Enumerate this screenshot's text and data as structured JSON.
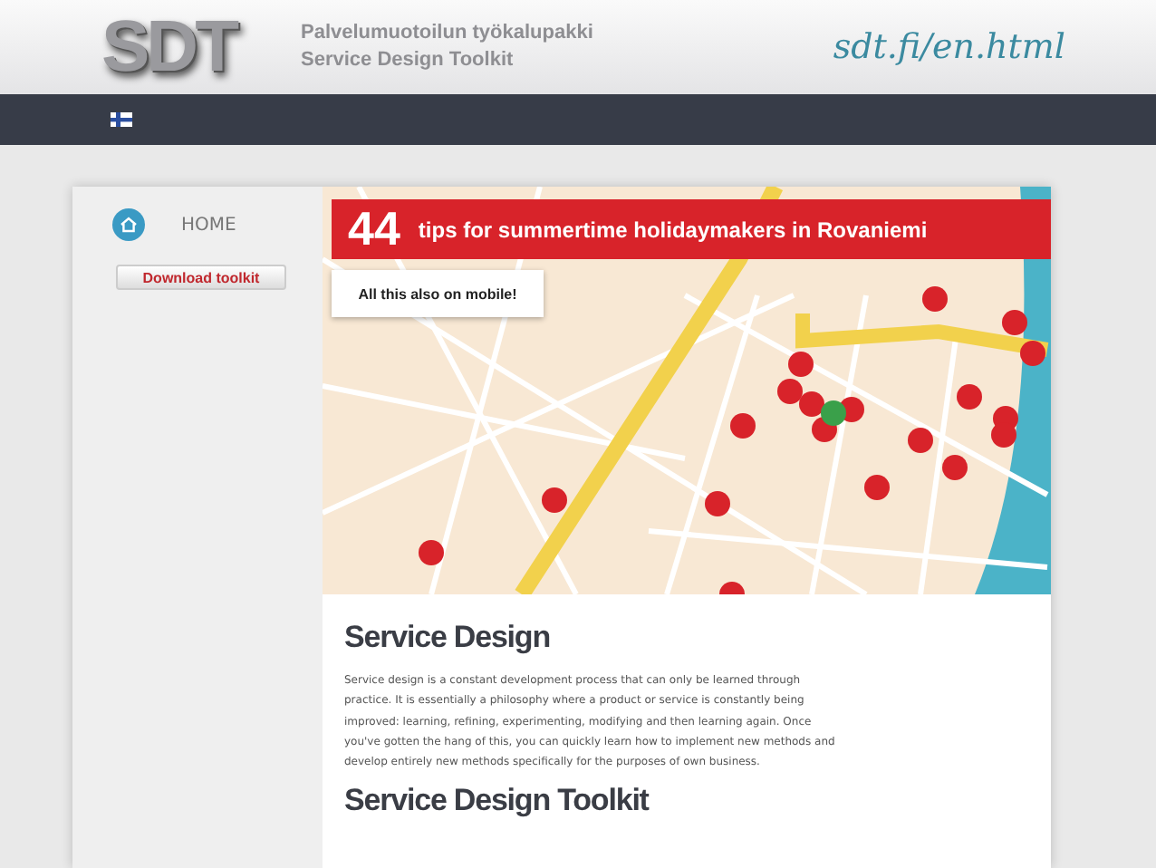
{
  "header": {
    "logo": "SDT",
    "tagline_fi": "Palvelumuotoilun työkalupakki",
    "tagline_en": "Service Design Toolkit",
    "url": "sdt.fi/en.html"
  },
  "sidebar": {
    "home": "HOME",
    "download_button": "Download toolkit"
  },
  "banner": {
    "number": "44",
    "text": "tips for summertime holidaymakers in Rovaniemi"
  },
  "map_popup": "All this also on mobile!",
  "sections": [
    {
      "heading": "Service Design",
      "body": "Service design is a constant development process that can only be learned through practice. It is essentially a philosophy where a product or service is constantly being improved: learning, refining, experimenting, modifying and then learning again. Once you've gotten the hang of this, you can quickly learn how to implement new methods and develop entirely new methods specifically for the purposes of own business."
    },
    {
      "heading": "Service Design Toolkit"
    }
  ]
}
